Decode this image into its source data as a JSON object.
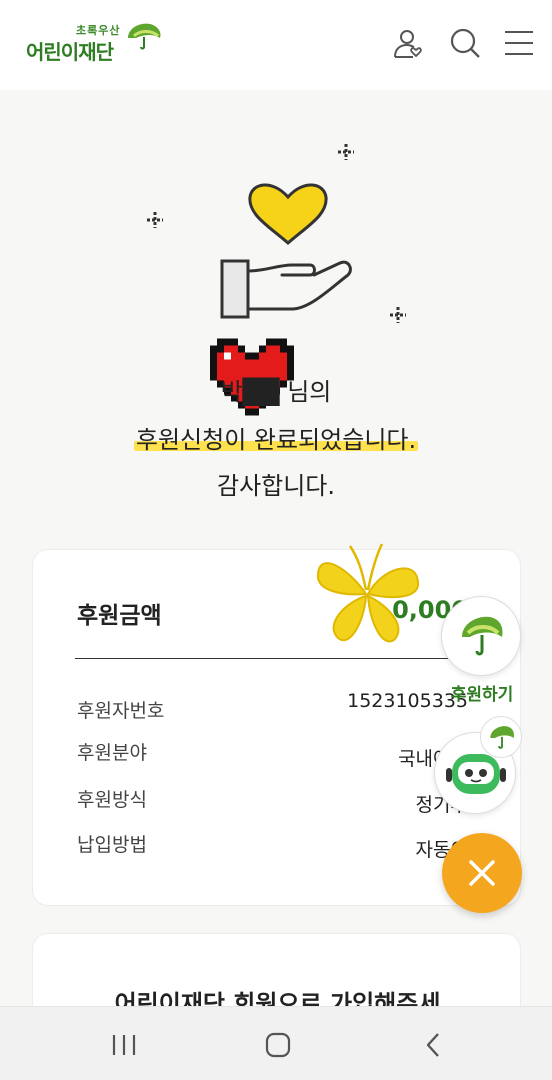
{
  "header": {
    "logo_tagline": "초록우산",
    "logo_name": "어린이재단",
    "icons": [
      "user-heart-icon",
      "search-icon",
      "menu-icon"
    ]
  },
  "message": {
    "name_line": "박██ 님의",
    "complete_line": "후원신청이 완료되었습니다.",
    "thanks_line": "감사합니다."
  },
  "donation_card": {
    "amount_label": "후원금액",
    "amount_value": "0,000",
    "rows": [
      {
        "label": "후원자번호",
        "value": "1523105335"
      },
      {
        "label": "후원분야",
        "value": "국내아동"
      },
      {
        "label": "후원방식",
        "value": "정기후"
      },
      {
        "label": "납입방법",
        "value": "자동이"
      }
    ]
  },
  "join_card": {
    "title": "어린이재단 회원으로 가입해주세"
  },
  "floating": {
    "donate_label": "후원하기"
  },
  "colors": {
    "brand_green": "#2f7d23",
    "highlight_yellow": "#ffe14d",
    "close_orange": "#f5a61f"
  },
  "navbar": {
    "icons": [
      "recent-apps-icon",
      "home-icon",
      "back-icon"
    ]
  }
}
